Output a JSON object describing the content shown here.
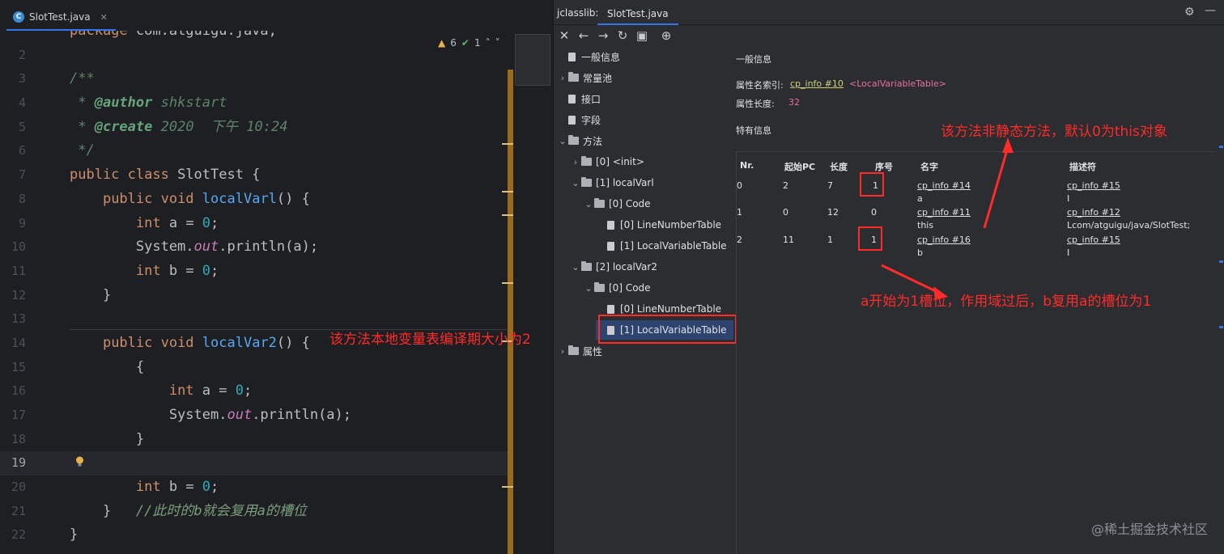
{
  "editor": {
    "tab": {
      "label": "SlotTest.java",
      "icon": "java-class-icon"
    },
    "inspections": {
      "warnings": "6",
      "checks": "1"
    },
    "lines": [
      {
        "num": "",
        "text": "package com.atguigu.java;"
      },
      {
        "num": "2",
        "text": ""
      },
      {
        "num": "3",
        "text": "/**"
      },
      {
        "num": "4",
        "text": " * @author shkstart"
      },
      {
        "num": "5",
        "text": " * @create 2020  下午 10:24"
      },
      {
        "num": "6",
        "text": " */"
      },
      {
        "num": "7",
        "text": "public class SlotTest {"
      },
      {
        "num": "8",
        "text": "    public void localVarl() {"
      },
      {
        "num": "9",
        "text": "        int a = 0;"
      },
      {
        "num": "10",
        "text": "        System.out.println(a);"
      },
      {
        "num": "11",
        "text": "        int b = 0;"
      },
      {
        "num": "12",
        "text": "    }"
      },
      {
        "num": "13",
        "text": ""
      },
      {
        "num": "14",
        "text": "    public void localVar2() {"
      },
      {
        "num": "15",
        "text": "        {"
      },
      {
        "num": "16",
        "text": "            int a = 0;"
      },
      {
        "num": "17",
        "text": "            System.out.println(a);"
      },
      {
        "num": "18",
        "text": "        }"
      },
      {
        "num": "19",
        "text": "        //此时的b就会复用a的槽位"
      },
      {
        "num": "20",
        "text": "        int b = 0;"
      },
      {
        "num": "21",
        "text": "    }"
      },
      {
        "num": "22",
        "text": "}"
      }
    ],
    "annotation": "该方法本地变量表编译期大小为2"
  },
  "jclasslib": {
    "title": "jclasslib:",
    "tab": "SlotTest.java",
    "tree": {
      "general": "一般信息",
      "constant_pool": "常量池",
      "interfaces": "接口",
      "fields": "字段",
      "methods": "方法",
      "m0": "[0] <init>",
      "m1": "[1] localVarl",
      "m1_code": "[0] Code",
      "m1_lnt": "[0] LineNumberTable",
      "m1_lvt": "[1] LocalVariableTable",
      "m2": "[2] localVar2",
      "m2_code": "[0] Code",
      "m2_lnt": "[0] LineNumberTable",
      "m2_lvt": "[1] LocalVariableTable",
      "attributes": "属性"
    },
    "detail": {
      "general_title": "一般信息",
      "attr_name_label": "属性名索引:",
      "attr_name_link": "cp_info #10",
      "attr_name_value": "<LocalVariableTable>",
      "attr_len_label": "属性长度:",
      "attr_len_value": "32",
      "specific_title": "特有信息",
      "columns": [
        "Nr.",
        "起始PC",
        "长度",
        "序号",
        "名字",
        "描述符"
      ],
      "rows": [
        {
          "nr": "0",
          "pc": "2",
          "len": "7",
          "idx": "1",
          "name_link": "cp_info #14",
          "name": "a",
          "desc_link": "cp_info #15",
          "desc": "I"
        },
        {
          "nr": "1",
          "pc": "0",
          "len": "12",
          "idx": "0",
          "name_link": "cp_info #11",
          "name": "this",
          "desc_link": "cp_info #12",
          "desc": "Lcom/atguigu/java/SlotTest;"
        },
        {
          "nr": "2",
          "pc": "11",
          "len": "1",
          "idx": "1",
          "name_link": "cp_info #16",
          "name": "b",
          "desc_link": "cp_info #15",
          "desc": "I"
        }
      ]
    },
    "annotations": {
      "top": "该方法非静态方法，默认0为this对象",
      "bottom": "a开始为1槽位，作用域过后，b复用a的槽位为1"
    }
  },
  "watermark": "@稀土掘金技术社区",
  "colors": {
    "annotation": "#ff2a2a",
    "accent": "#3574f0",
    "link": "#cfd17a"
  }
}
